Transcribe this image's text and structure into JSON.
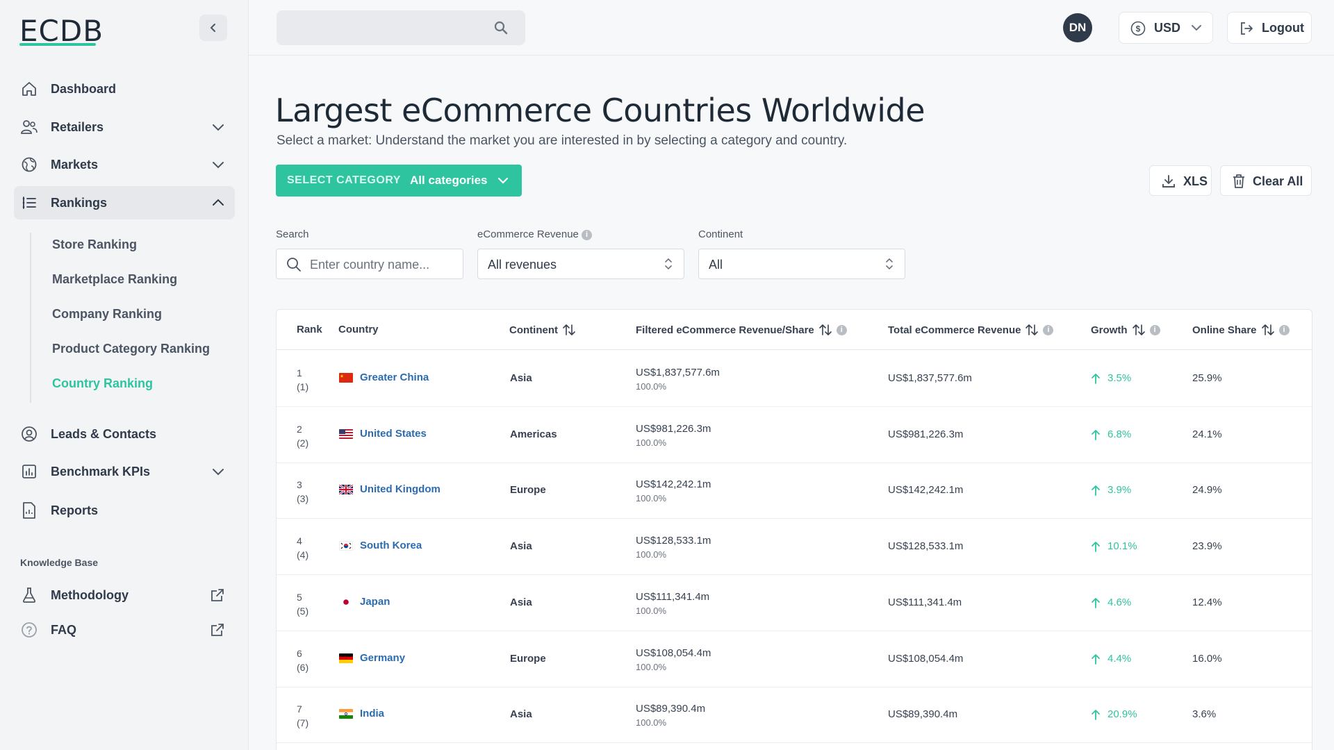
{
  "app": {
    "logo": "ECDB"
  },
  "sidebar": {
    "items": [
      {
        "label": "Dashboard",
        "icon": "home-icon"
      },
      {
        "label": "Retailers",
        "icon": "users-icon"
      },
      {
        "label": "Markets",
        "icon": "globe-icon"
      },
      {
        "label": "Rankings",
        "icon": "list-icon"
      },
      {
        "label": "Leads & Contacts",
        "icon": "contact-icon"
      },
      {
        "label": "Benchmark KPIs",
        "icon": "bar-chart-icon"
      },
      {
        "label": "Reports",
        "icon": "document-icon"
      }
    ],
    "rankings_sub": [
      "Store Ranking",
      "Marketplace Ranking",
      "Company Ranking",
      "Product Category Ranking",
      "Country Ranking"
    ],
    "kb_title": "Knowledge Base",
    "kb_items": [
      {
        "label": "Methodology",
        "icon": "flask-icon"
      },
      {
        "label": "FAQ",
        "icon": "help-icon"
      }
    ]
  },
  "topbar": {
    "search_placeholder": "",
    "avatar": "DN",
    "currency": "USD",
    "logout": "Logout"
  },
  "page": {
    "title": "Largest eCommerce Countries Worldwide",
    "subtitle": "Select a market: Understand the market you are interested in by selecting a category and country.",
    "category_key": "SELECT CATEGORY",
    "category_value": "All categories",
    "xls": "XLS",
    "clear_all": "Clear All"
  },
  "filters": {
    "search_label": "Search",
    "search_placeholder": "Enter country name...",
    "revenue_label": "eCommerce Revenue",
    "revenue_value": "All revenues",
    "continent_label": "Continent",
    "continent_value": "All"
  },
  "table": {
    "headers": {
      "rank": "Rank",
      "country": "Country",
      "continent": "Continent",
      "filtered": "Filtered eCommerce Revenue/Share",
      "total": "Total eCommerce Revenue",
      "growth": "Growth",
      "online": "Online Share"
    },
    "rows": [
      {
        "rank": "1",
        "prev": "(1)",
        "country": "Greater China",
        "flag": "cn",
        "continent": "Asia",
        "filtered": "US$1,837,577.6m",
        "share": "100.0%",
        "total": "US$1,837,577.6m",
        "growth": "3.5%",
        "online": "25.9%"
      },
      {
        "rank": "2",
        "prev": "(2)",
        "country": "United States",
        "flag": "us",
        "continent": "Americas",
        "filtered": "US$981,226.3m",
        "share": "100.0%",
        "total": "US$981,226.3m",
        "growth": "6.8%",
        "online": "24.1%"
      },
      {
        "rank": "3",
        "prev": "(3)",
        "country": "United Kingdom",
        "flag": "gb",
        "continent": "Europe",
        "filtered": "US$142,242.1m",
        "share": "100.0%",
        "total": "US$142,242.1m",
        "growth": "3.9%",
        "online": "24.9%"
      },
      {
        "rank": "4",
        "prev": "(4)",
        "country": "South Korea",
        "flag": "kr",
        "continent": "Asia",
        "filtered": "US$128,533.1m",
        "share": "100.0%",
        "total": "US$128,533.1m",
        "growth": "10.1%",
        "online": "23.9%"
      },
      {
        "rank": "5",
        "prev": "(5)",
        "country": "Japan",
        "flag": "jp",
        "continent": "Asia",
        "filtered": "US$111,341.4m",
        "share": "100.0%",
        "total": "US$111,341.4m",
        "growth": "4.6%",
        "online": "12.4%"
      },
      {
        "rank": "6",
        "prev": "(6)",
        "country": "Germany",
        "flag": "de",
        "continent": "Europe",
        "filtered": "US$108,054.4m",
        "share": "100.0%",
        "total": "US$108,054.4m",
        "growth": "4.4%",
        "online": "16.0%"
      },
      {
        "rank": "7",
        "prev": "(7)",
        "country": "India",
        "flag": "in",
        "continent": "Asia",
        "filtered": "US$89,390.4m",
        "share": "100.0%",
        "total": "US$89,390.4m",
        "growth": "20.9%",
        "online": "3.6%"
      }
    ]
  },
  "colors": {
    "accent": "#2ec4a0",
    "link": "#2b6cb0",
    "dark": "#2f3b4a"
  }
}
